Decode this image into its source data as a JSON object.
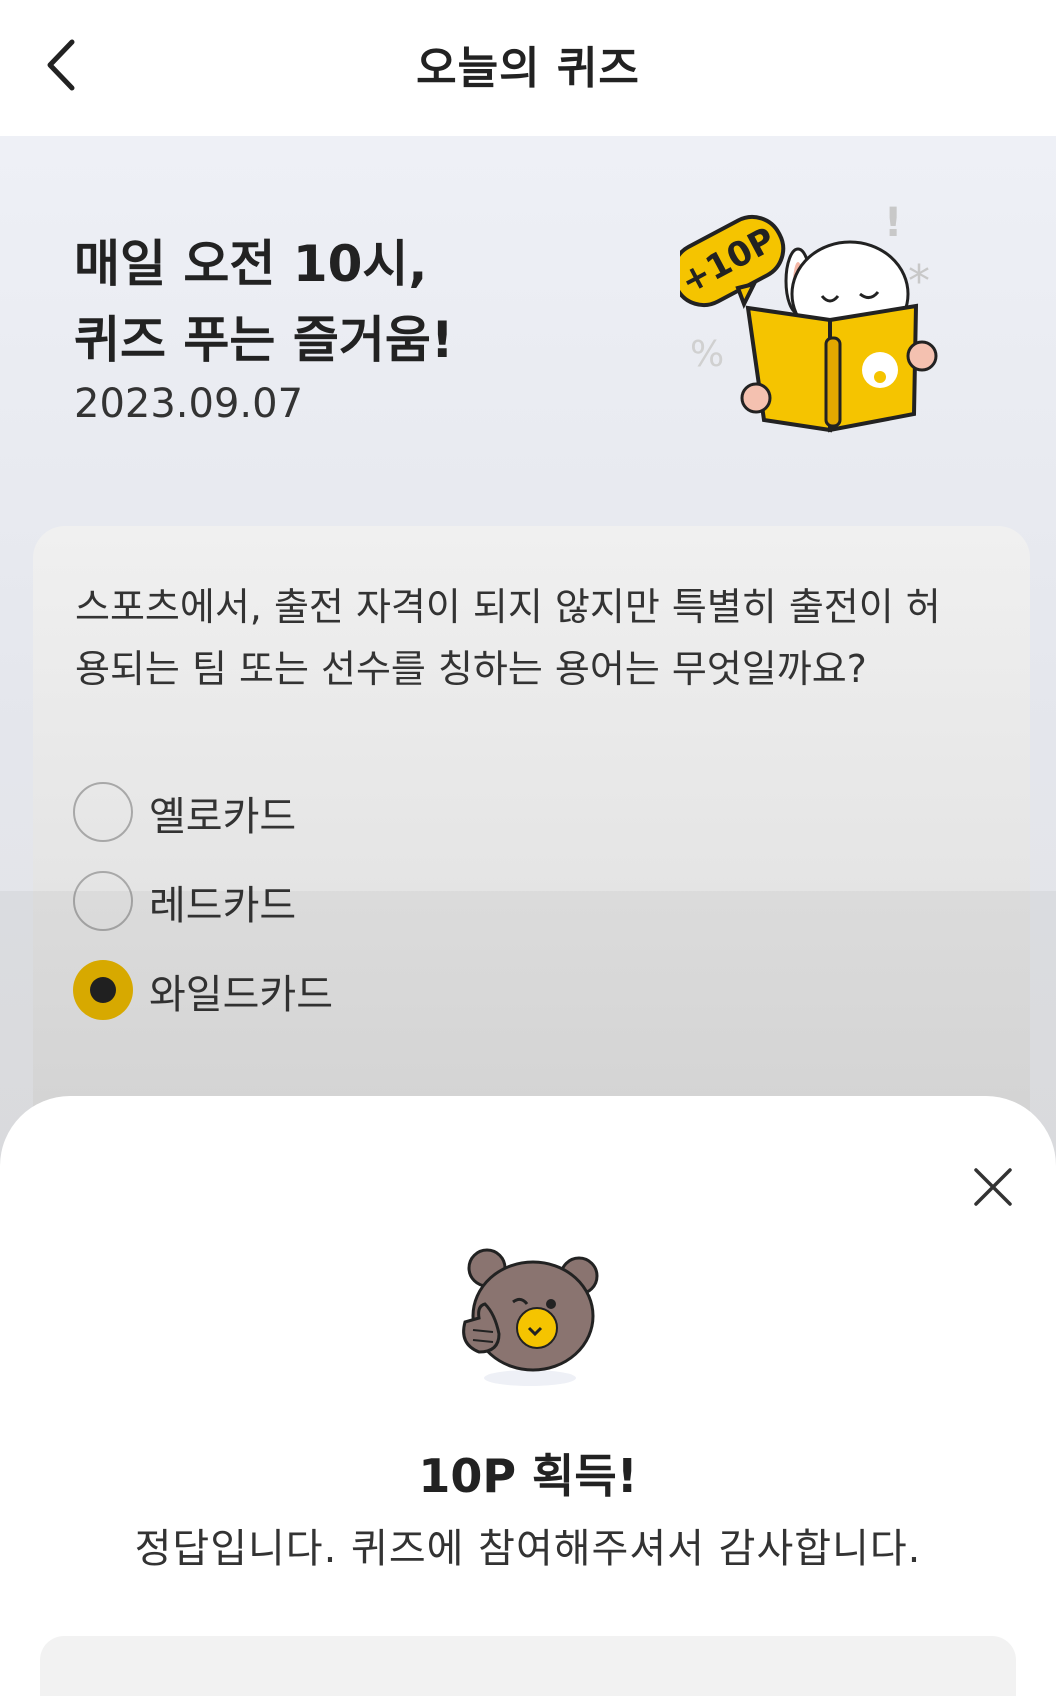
{
  "header": {
    "title": "오늘의 퀴즈",
    "back_icon": "chevron-left-icon"
  },
  "hero": {
    "title_line1": "매일 오전 10시,",
    "title_line2": "퀴즈 푸는 즐거움!",
    "date": "2023.09.07",
    "badge": "+10P"
  },
  "quiz": {
    "question": "스포츠에서, 출전 자격이 되지 않지만 특별히 출전이 허용되는 팀 또는 선수를 칭하는 용어는 무엇일까요?",
    "options": [
      {
        "label": "옐로카드",
        "selected": false
      },
      {
        "label": "레드카드",
        "selected": false
      },
      {
        "label": "와일드카드",
        "selected": true
      }
    ]
  },
  "result": {
    "title": "10P 획득!",
    "message": "정답입니다. 퀴즈에 참여해주셔서 감사합니다.",
    "close_icon": "close-icon"
  },
  "colors": {
    "accent": "#e0b000",
    "book": "#f5c400",
    "bear": "#8a7470"
  }
}
